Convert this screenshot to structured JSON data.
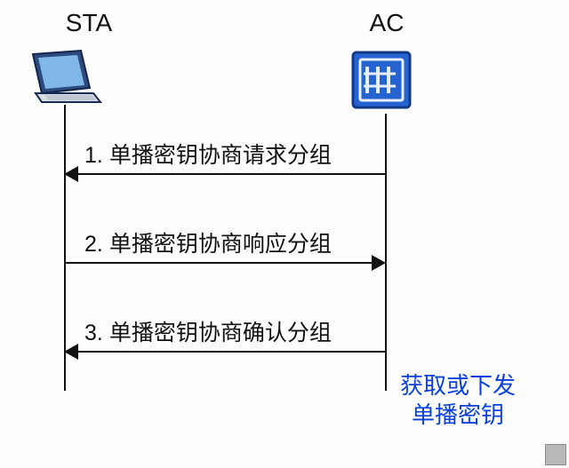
{
  "participants": {
    "left": {
      "name": "STA"
    },
    "right": {
      "name": "AC"
    }
  },
  "messages": [
    {
      "num": "1",
      "text": "单播密钥协商请求分组",
      "dir": "left"
    },
    {
      "num": "2",
      "text": "单播密钥协商响应分组",
      "dir": "right"
    },
    {
      "num": "3",
      "text": "单播密钥协商确认分组",
      "dir": "left"
    }
  ],
  "note": {
    "line1": "获取或下发",
    "line2": "单播密钥"
  },
  "chart_data": {
    "type": "sequence-diagram",
    "participants": [
      "STA",
      "AC"
    ],
    "messages": [
      {
        "step": 1,
        "from": "AC",
        "to": "STA",
        "label": "单播密钥协商请求分组"
      },
      {
        "step": 2,
        "from": "STA",
        "to": "AC",
        "label": "单播密钥协商响应分组"
      },
      {
        "step": 3,
        "from": "AC",
        "to": "STA",
        "label": "单播密钥协商确认分组"
      }
    ],
    "notes": [
      {
        "at": "AC",
        "text": "获取或下发单播密钥"
      }
    ]
  }
}
